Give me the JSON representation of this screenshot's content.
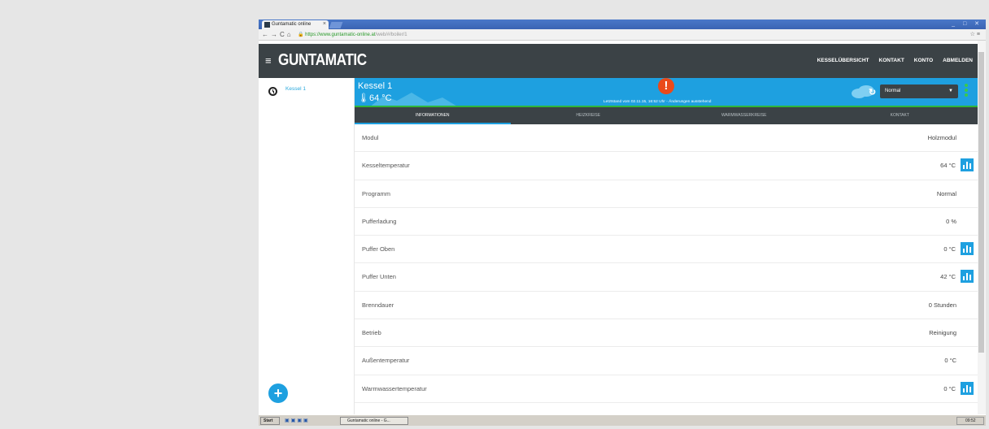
{
  "browser": {
    "tab_title": "Guntamatic online",
    "tab_close": "×",
    "url_host": "https://www.guntamatic-online.at",
    "url_path": "/web/#/boiler/1",
    "window_controls": "_ □ ✕"
  },
  "app": {
    "logo": "GUNTAMATIC",
    "nav": [
      "KESSELÜBERSICHT",
      "KONTAKT",
      "KONTO",
      "ABMELDEN"
    ]
  },
  "sidebar": {
    "items": [
      {
        "label": "Kessel 1"
      }
    ]
  },
  "boiler": {
    "name": "Kessel 1",
    "temperature": "64 °C",
    "status_message": "Letztstand vom 02.11.15, 16:52 Uhr - Änderungen ausstehend",
    "mode": "Normal"
  },
  "tabs": [
    "INFORMATIONEN",
    "HEIZKREISE",
    "WARMWASSERKREISE",
    "KONTAKT"
  ],
  "info_rows": [
    {
      "label": "Modul",
      "value": "Holzmodul",
      "chart": false
    },
    {
      "label": "Kesseltemperatur",
      "value": "64 °C",
      "chart": true
    },
    {
      "label": "Programm",
      "value": "Normal",
      "chart": false
    },
    {
      "label": "Pufferladung",
      "value": "0 %",
      "chart": false
    },
    {
      "label": "Puffer Oben",
      "value": "0 °C",
      "chart": true
    },
    {
      "label": "Puffer Unten",
      "value": "42 °C",
      "chart": true
    },
    {
      "label": "Brenndauer",
      "value": "0 Stunden",
      "chart": false
    },
    {
      "label": "Betrieb",
      "value": "Reinigung",
      "chart": false
    },
    {
      "label": "Außentemperatur",
      "value": "0 °C",
      "chart": false
    },
    {
      "label": "Warmwassertemperatur",
      "value": "0 °C",
      "chart": true
    }
  ],
  "taskbar": {
    "start": "Start",
    "task": "Guntamatic online - G...",
    "clock": "09:52"
  },
  "colors": {
    "accent": "#1ea0e0",
    "header": "#3b4246",
    "alert": "#ea4a1a",
    "status_line": "#2fb53a"
  }
}
